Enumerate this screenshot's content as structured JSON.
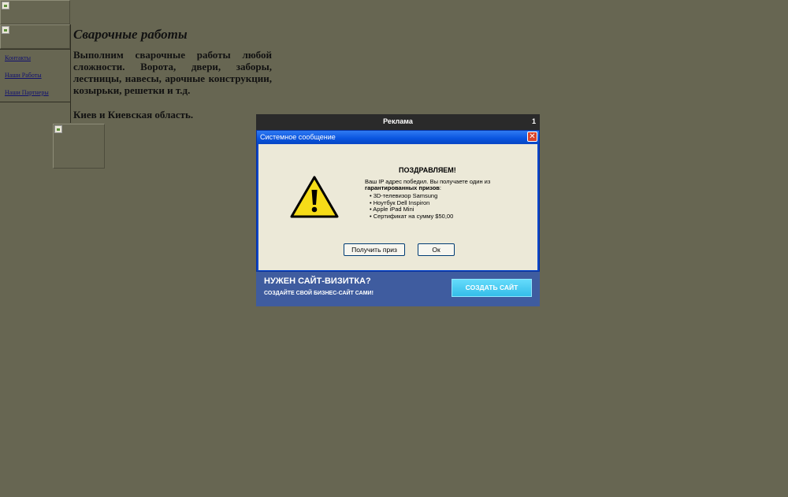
{
  "page": {
    "title": "Сварочные работы",
    "description": "Выполним сварочные работы любой сложности. Ворота, двери, заборы, лестницы, навесы, арочные конструкции, козырьки, решетки и т.д.",
    "region": "Киев и Киевская область."
  },
  "sidebar": {
    "items": [
      {
        "label": "Контакты"
      },
      {
        "label": "Наши Работы"
      },
      {
        "label": "Наши Партнеры"
      }
    ]
  },
  "ad": {
    "header": "Реклама",
    "close_label": "1",
    "system_window": {
      "title": "Системное сообщение",
      "close_glyph": "✕",
      "heading": "ПОЗДРАВЛЯЕМ!",
      "text_intro": "Ваш IP адрес победил. Вы получаете один из ",
      "text_bold": "гарантированных призов",
      "text_end": ":",
      "prizes": [
        "3D-телевизор Samsung",
        "Ноутбук Dell Inspiron",
        "Apple iPad Mini",
        "Сертификат на сумму $50,00"
      ],
      "get_prize_label": "Получить приз",
      "ok_label": "Ок"
    },
    "banner": {
      "title": "НУЖЕН САЙТ-ВИЗИТКА?",
      "subtitle": "СОЗДАЙТЕ СВОЙ БИЗНЕС-САЙТ САМИ!",
      "button_label": "СОЗДАТЬ САЙТ"
    }
  },
  "colors": {
    "background": "#676652",
    "xp_blue": "#0a47c9",
    "dialog_body": "#ece9d8",
    "banner": "#3f5c9f",
    "banner_button": "#45c8f0"
  },
  "icons": {
    "warning": "warning-icon",
    "close": "close-icon",
    "broken_image": "broken-image-icon"
  }
}
